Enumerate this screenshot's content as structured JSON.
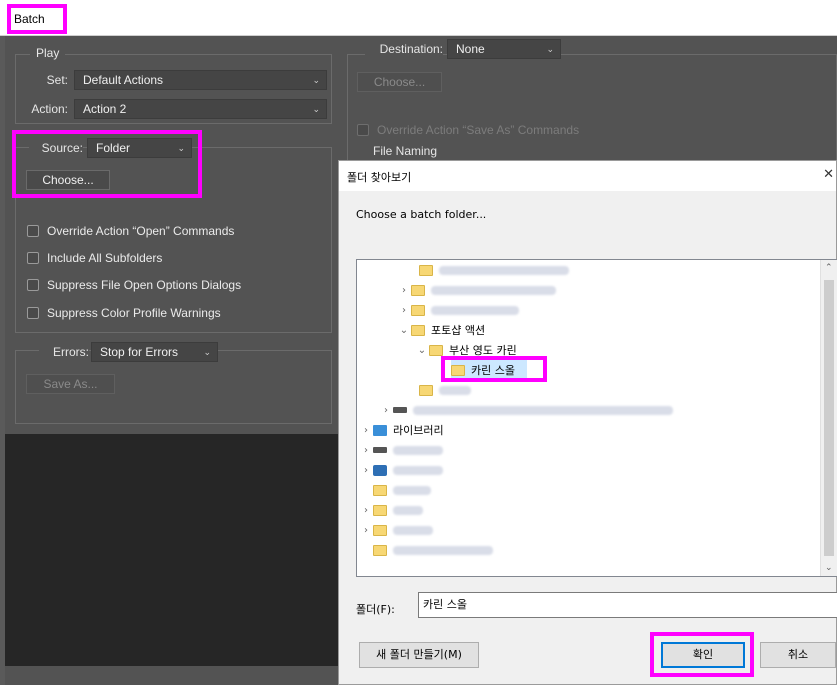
{
  "batch": {
    "title": "Batch",
    "play": {
      "legend": "Play",
      "set_label": "Set:",
      "set_value": "Default Actions",
      "action_label": "Action:",
      "action_value": "Action 2"
    },
    "source": {
      "label": "Source:",
      "value": "Folder",
      "choose_label": "Choose...",
      "checkboxes": [
        {
          "label": "Override Action “Open” Commands",
          "checked": false
        },
        {
          "label": "Include All Subfolders",
          "checked": false
        },
        {
          "label": "Suppress File Open Options Dialogs",
          "checked": false
        },
        {
          "label": "Suppress Color Profile Warnings",
          "checked": false
        }
      ]
    },
    "errors": {
      "label": "Errors:",
      "value": "Stop for Errors",
      "save_as_label": "Save As..."
    },
    "destination": {
      "label": "Destination:",
      "value": "None",
      "choose_label": "Choose...",
      "override_label": "Override Action “Save As” Commands",
      "file_naming_label": "File Naming"
    }
  },
  "dialog": {
    "title": "폴더 찾아보기",
    "close_glyph": "✕",
    "prompt": "Choose a batch folder...",
    "tree": {
      "photoshop_actions": "포토샵 액션",
      "busan": "부산 영도 카린",
      "selected_folder": "카린 스올",
      "libraries": "라이브러리"
    },
    "folder_field_label": "폴더(F):",
    "folder_field_value": "카린 스올",
    "new_folder_label": "새 폴더 만들기(M)",
    "ok_label": "확인",
    "cancel_label": "취소"
  },
  "colors": {
    "highlight": "#ff00ff",
    "ps_panel": "#535353",
    "win_accent": "#0078d7"
  }
}
